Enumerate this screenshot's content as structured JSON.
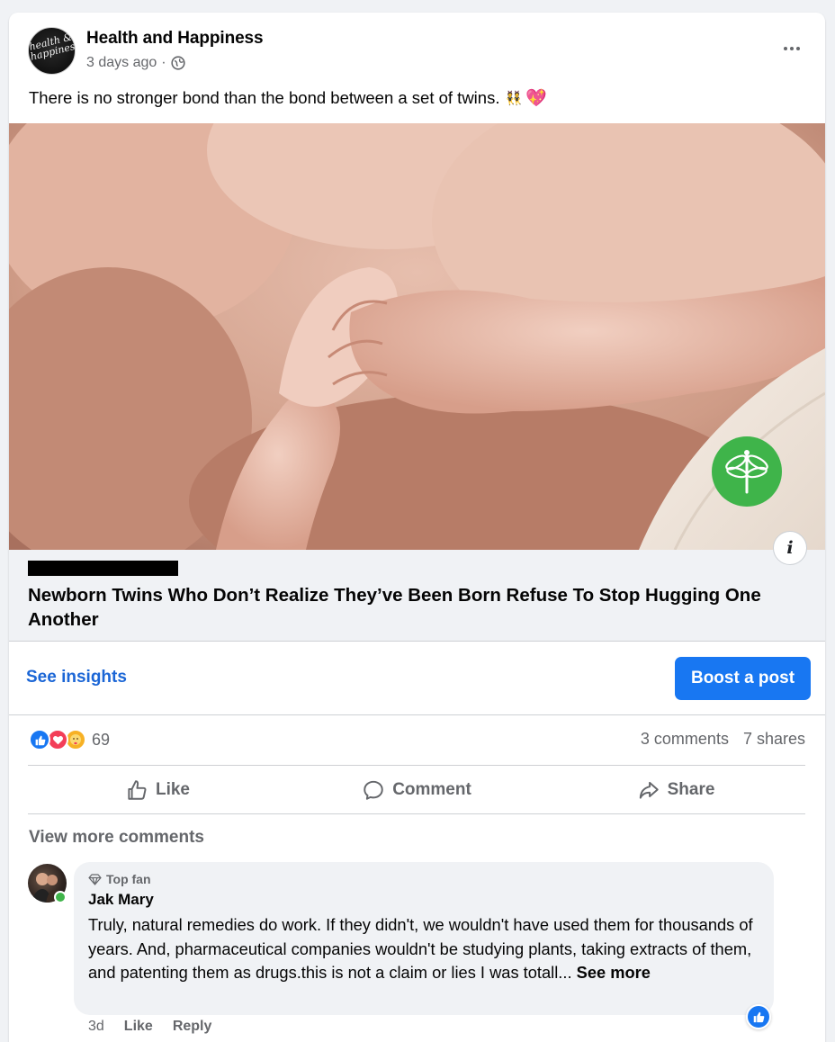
{
  "post": {
    "page_name": "Health and Happiness",
    "avatar_text": "health & happiness",
    "time": "3 days ago",
    "meta_sep": "·",
    "caption": "There is no stronger bond than the bond between a set of twins.",
    "caption_emoji_1": "👯",
    "caption_emoji_2": "💖"
  },
  "link_preview": {
    "title": "Newborn Twins Who Don’t Realize They’ve Been Born Refuse To Stop Hugging One Another",
    "info_label": "i"
  },
  "insights": {
    "see_insights": "See insights",
    "boost": "Boost a post"
  },
  "stats": {
    "reactions_count": "69",
    "comments": "3 comments",
    "shares": "7 shares"
  },
  "actions": {
    "like": "Like",
    "comment": "Comment",
    "share": "Share"
  },
  "comments": {
    "view_more": "View more comments",
    "items": [
      {
        "badge": "Top fan",
        "author": "Jak Mary",
        "text": "Truly, natural remedies do work. If they didn't, we wouldn't have used them for thousands of years. And, pharmaceutical companies wouldn't be studying plants, taking extracts of them, and patenting them as drugs.this is not a claim or lies I was totall...",
        "see_more": "See more",
        "age": "3d",
        "like": "Like",
        "reply": "Reply"
      }
    ]
  },
  "colors": {
    "accent": "#1877f2",
    "link": "#1b66d6",
    "secondary_text": "#65676b",
    "dragonfly_badge": "#3fb44a"
  }
}
